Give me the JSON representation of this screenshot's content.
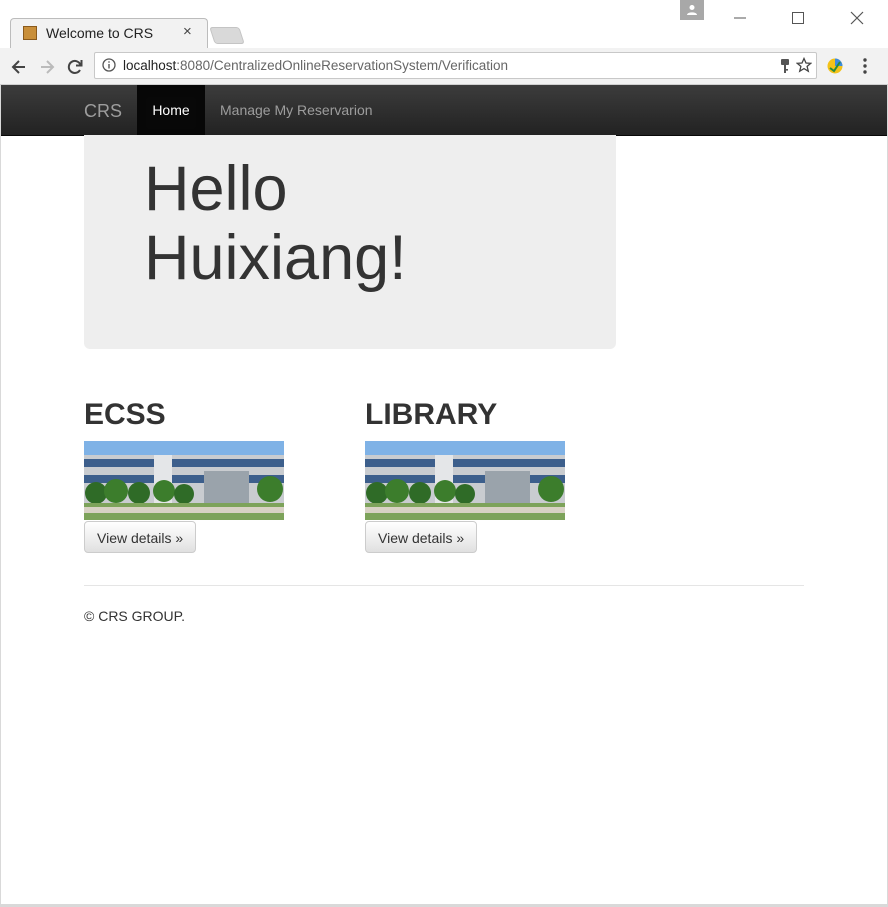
{
  "browser": {
    "tab_title": "Welcome to CRS",
    "tab_close": "×",
    "url_host": "localhost",
    "url_rest": ":8080/CentralizedOnlineReservationSystem/Verification"
  },
  "navbar": {
    "brand": "CRS",
    "home": "Home",
    "manage": "Manage My Reservarion"
  },
  "jumbotron": {
    "title": "Hello Huixiang!"
  },
  "columns": [
    {
      "title": "ECSS",
      "button": "View details »"
    },
    {
      "title": "LIBRARY",
      "button": "View details »"
    }
  ],
  "footer": "© CRS GROUP.",
  "colors": {
    "navbar": "#222222",
    "jumbotron": "#eeeeee",
    "text": "#333333"
  }
}
